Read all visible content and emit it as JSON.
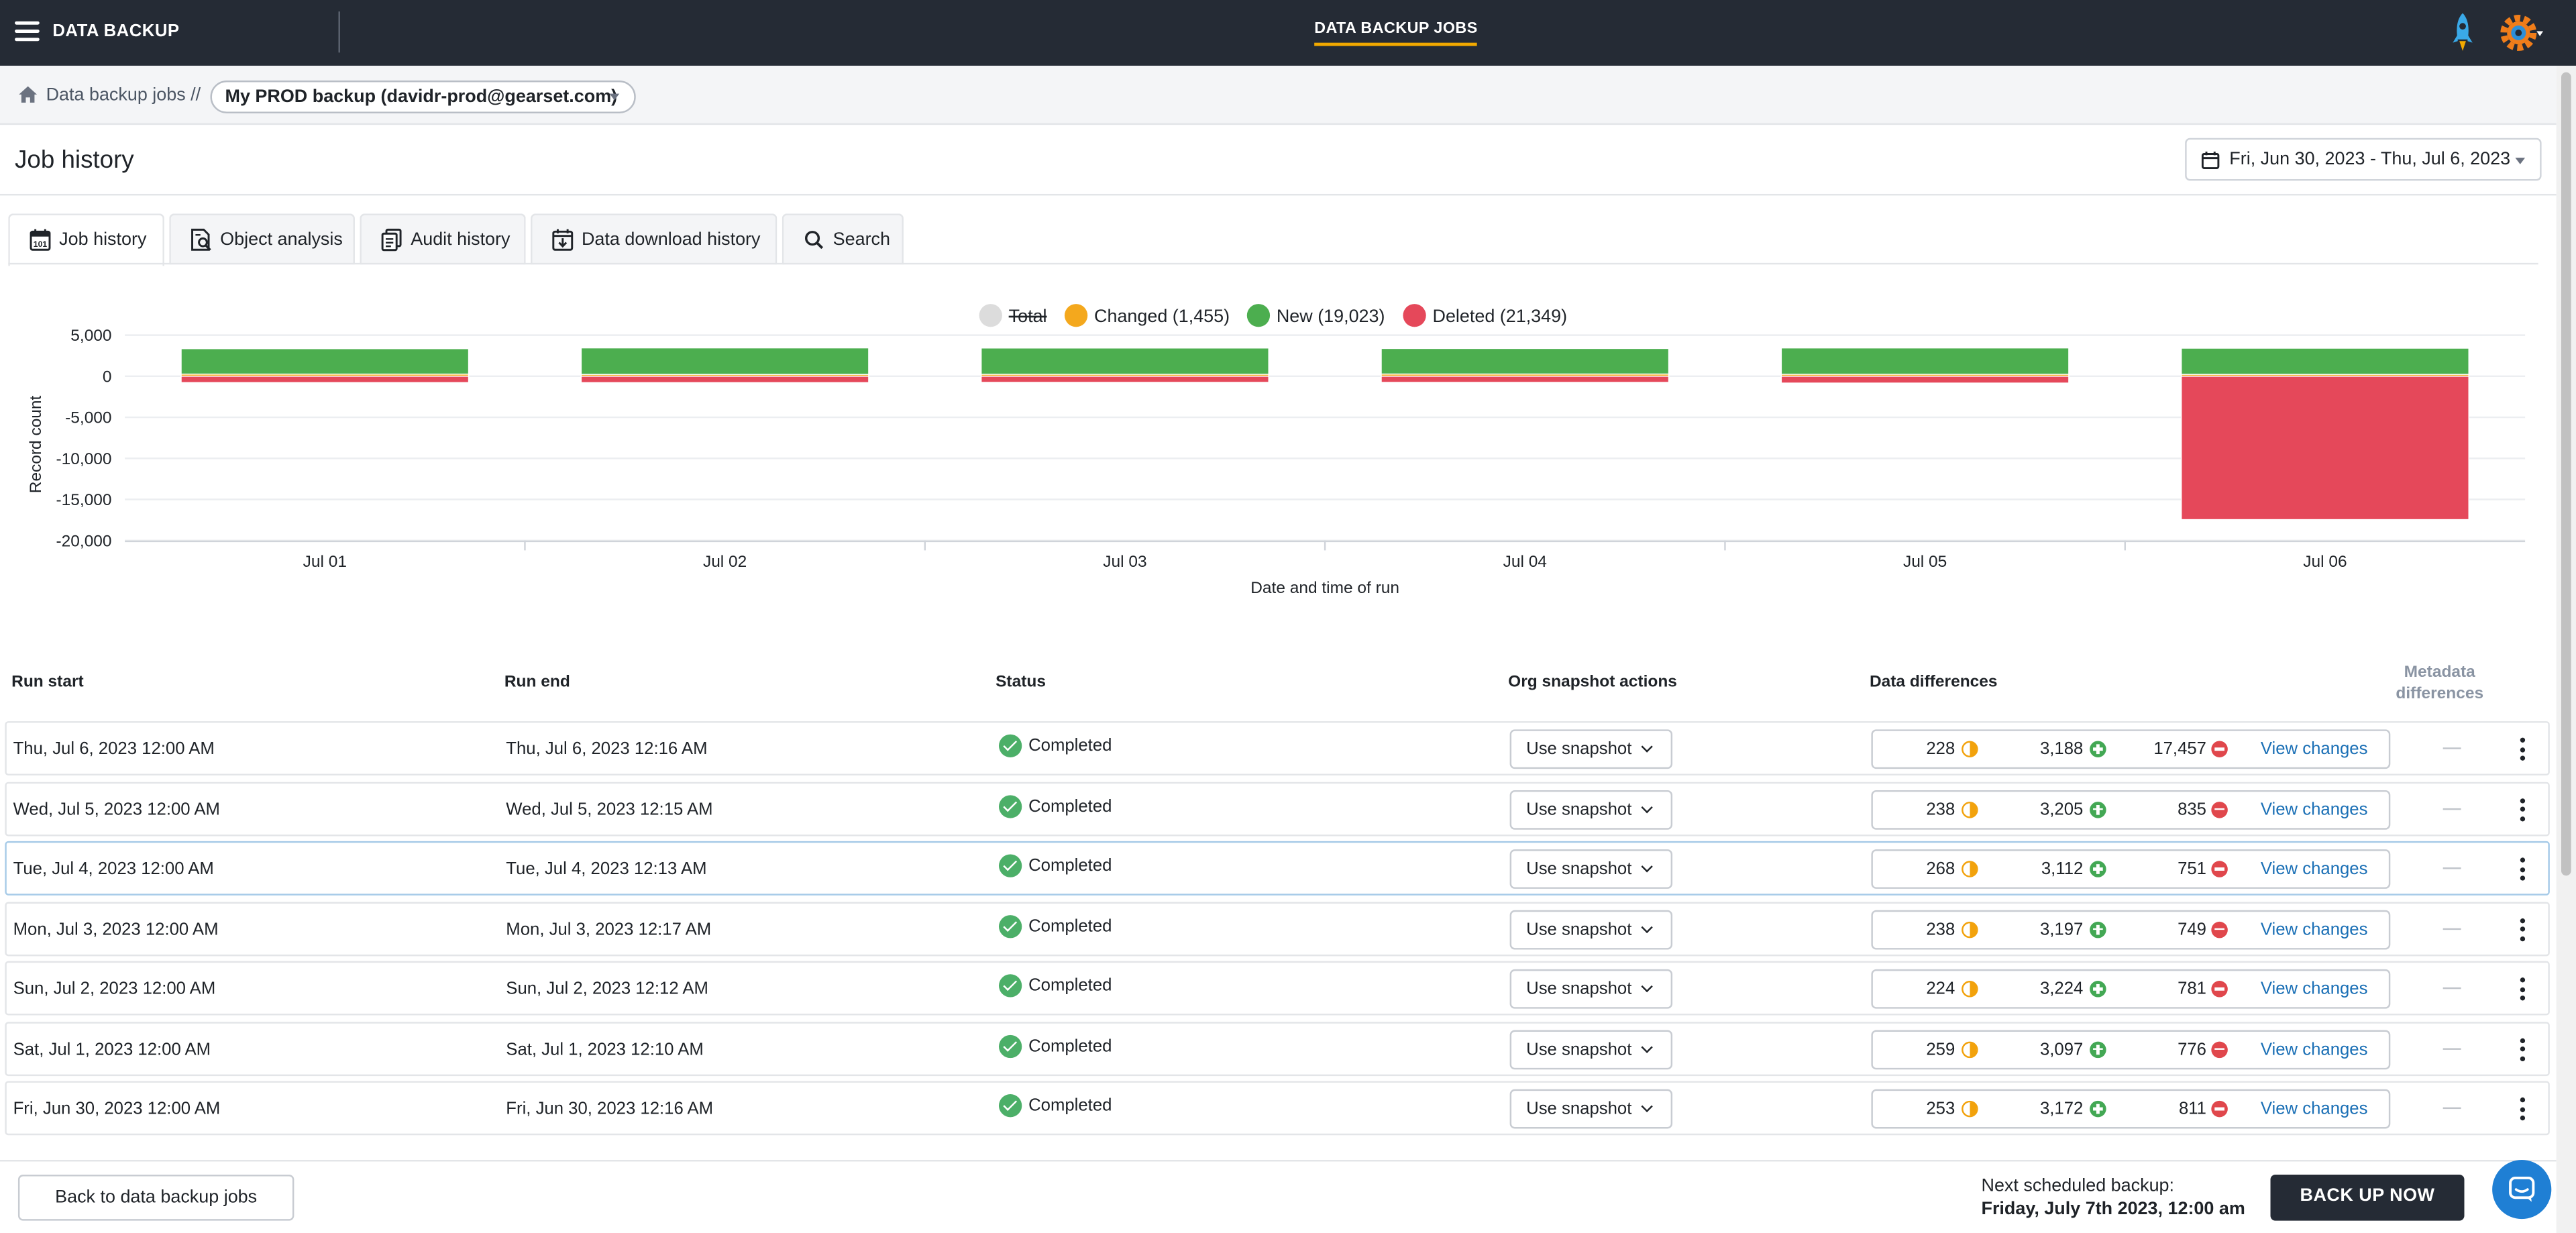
{
  "topbar": {
    "app_name": "DATA BACKUP",
    "nav_tab": "DATA BACKUP JOBS",
    "icons": [
      "menu-icon",
      "rocket-icon",
      "gear-icon"
    ]
  },
  "breadcrumb": {
    "link": "Data backup jobs",
    "separator": "//",
    "current_job": "My PROD backup (davidr-prod@gearset.com)"
  },
  "page": {
    "title": "Job history",
    "date_range": "Fri, Jun 30, 2023 - Thu, Jul 6, 2023"
  },
  "tabs": [
    {
      "label": "Job history",
      "icon": "calendar-icon",
      "active": true
    },
    {
      "label": "Object analysis",
      "icon": "document-search-icon",
      "active": false
    },
    {
      "label": "Audit history",
      "icon": "documents-icon",
      "active": false
    },
    {
      "label": "Data download history",
      "icon": "download-calendar-icon",
      "active": false
    },
    {
      "label": "Search",
      "icon": "search-icon",
      "active": false
    }
  ],
  "chart_data": {
    "type": "bar",
    "stacked": true,
    "xlabel": "Date and time of run",
    "ylabel": "Record count",
    "ylim": [
      -20000,
      5000
    ],
    "yticks": [
      "5,000",
      "0",
      "-5,000",
      "-10,000",
      "-15,000",
      "-20,000"
    ],
    "yticks_values": [
      5000,
      0,
      -5000,
      -10000,
      -15000,
      -20000
    ],
    "categories": [
      "Jul 01",
      "Jul 02",
      "Jul 03",
      "Jul 04",
      "Jul 05",
      "Jul 06"
    ],
    "legend": [
      {
        "label": "Total",
        "color": "#dcdcdc",
        "hidden": true
      },
      {
        "label": "Changed (1,455)",
        "color": "#f4a81d"
      },
      {
        "label": "New (19,023)",
        "color": "#4cae4f"
      },
      {
        "label": "Deleted (21,349)",
        "color": "#e5485a"
      }
    ],
    "series": [
      {
        "name": "Changed",
        "color": "#f4a81d",
        "values": [
          259,
          224,
          238,
          268,
          238,
          228
        ]
      },
      {
        "name": "New",
        "color": "#4cae4f",
        "values": [
          3097,
          3224,
          3197,
          3112,
          3205,
          3188
        ]
      },
      {
        "name": "Deleted",
        "color": "#e5485a",
        "values": [
          -776,
          -781,
          -749,
          -751,
          -835,
          -17457
        ]
      }
    ],
    "grid": true
  },
  "table": {
    "headers": {
      "run_start": "Run start",
      "run_end": "Run end",
      "status": "Status",
      "snapshot": "Org snapshot actions",
      "data_diff": "Data differences",
      "meta_diff": "Metadata differences"
    },
    "rows": [
      {
        "run_start": "Thu, Jul 6, 2023 12:00 AM",
        "run_end": "Thu, Jul 6, 2023 12:16 AM",
        "status": "Completed",
        "snapshot": "Use snapshot",
        "changed": "228",
        "new": "3,188",
        "deleted": "17,457",
        "link": "View changes",
        "meta": "—"
      },
      {
        "run_start": "Wed, Jul 5, 2023 12:00 AM",
        "run_end": "Wed, Jul 5, 2023 12:15 AM",
        "status": "Completed",
        "snapshot": "Use snapshot",
        "changed": "238",
        "new": "3,205",
        "deleted": "835",
        "link": "View changes",
        "meta": "—"
      },
      {
        "run_start": "Tue, Jul 4, 2023 12:00 AM",
        "run_end": "Tue, Jul 4, 2023 12:13 AM",
        "status": "Completed",
        "snapshot": "Use snapshot",
        "changed": "268",
        "new": "3,112",
        "deleted": "751",
        "link": "View changes",
        "meta": "—"
      },
      {
        "run_start": "Mon, Jul 3, 2023 12:00 AM",
        "run_end": "Mon, Jul 3, 2023 12:17 AM",
        "status": "Completed",
        "snapshot": "Use snapshot",
        "changed": "238",
        "new": "3,197",
        "deleted": "749",
        "link": "View changes",
        "meta": "—"
      },
      {
        "run_start": "Sun, Jul 2, 2023 12:00 AM",
        "run_end": "Sun, Jul 2, 2023 12:12 AM",
        "status": "Completed",
        "snapshot": "Use snapshot",
        "changed": "224",
        "new": "3,224",
        "deleted": "781",
        "link": "View changes",
        "meta": "—"
      },
      {
        "run_start": "Sat, Jul 1, 2023 12:00 AM",
        "run_end": "Sat, Jul 1, 2023 12:10 AM",
        "status": "Completed",
        "snapshot": "Use snapshot",
        "changed": "259",
        "new": "3,097",
        "deleted": "776",
        "link": "View changes",
        "meta": "—"
      },
      {
        "run_start": "Fri, Jun 30, 2023 12:00 AM",
        "run_end": "Fri, Jun 30, 2023 12:16 AM",
        "status": "Completed",
        "snapshot": "Use snapshot",
        "changed": "253",
        "new": "3,172",
        "deleted": "811",
        "link": "View changes",
        "meta": "—"
      }
    ]
  },
  "footer": {
    "back_button": "Back to data backup jobs",
    "next_label": "Next scheduled backup:",
    "next_value": "Friday, July 7th 2023, 12:00 am",
    "backup_button": "BACK UP NOW"
  },
  "colors": {
    "topbar": "#252b35",
    "accent": "#f2a900",
    "link": "#1a6fb5",
    "success": "#4caf68"
  }
}
